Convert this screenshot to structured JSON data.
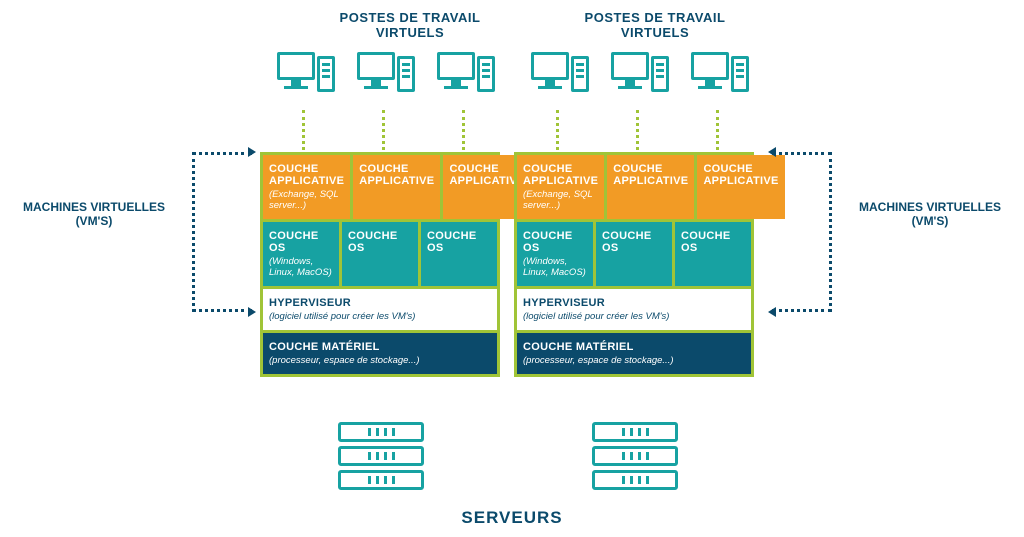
{
  "top_labels": {
    "left": "POSTES DE TRAVAIL VIRTUELS",
    "right": "POSTES DE TRAVAIL VIRTUELS"
  },
  "side_labels": {
    "left_line1": "MACHINES VIRTUELLES",
    "left_line2": "(VM'S)",
    "right_line1": "MACHINES VIRTUELLES",
    "right_line2": "(VM'S)"
  },
  "stack": {
    "app_label": "COUCHE APPLICATIVE",
    "app_sub": "(Exchange, SQL server...)",
    "os_label": "COUCHE OS",
    "os_sub": "(Windows, Linux, MacOS)",
    "hyper_label": "HYPERVISEUR",
    "hyper_sub": "(logiciel utilisé pour créer les VM's)",
    "mat_label": "COUCHE MATÉRIEL",
    "mat_sub": "(processeur, espace de stockage...)"
  },
  "bottom_label": "SERVEURS"
}
